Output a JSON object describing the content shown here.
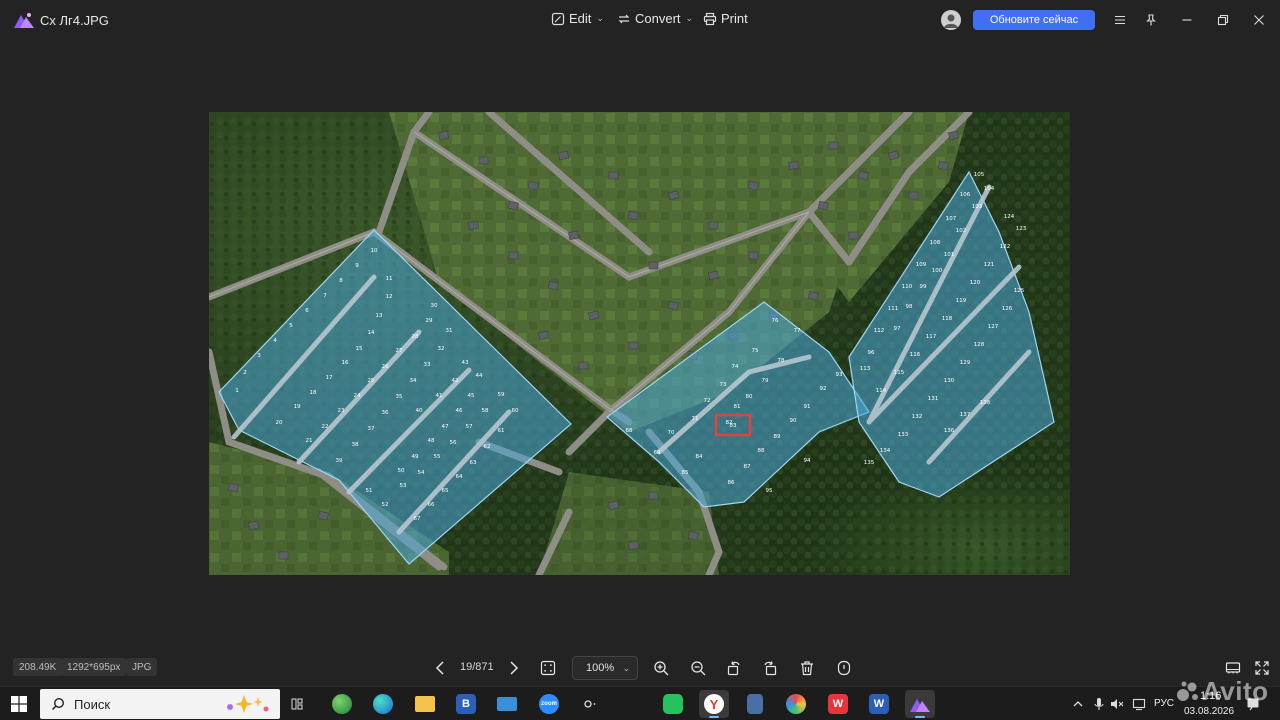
{
  "titlebar": {
    "file_name": "Сх Лг4.JPG",
    "edit_label": "Edit",
    "convert_label": "Convert",
    "print_label": "Print",
    "update_label": "Обновите сейчас"
  },
  "image": {
    "plot_labels": [
      "1",
      "2",
      "3",
      "4",
      "5",
      "6",
      "7",
      "8",
      "9",
      "10",
      "11",
      "12",
      "13",
      "14",
      "15",
      "16",
      "17",
      "18",
      "19",
      "20",
      "21",
      "22",
      "23",
      "24",
      "25",
      "26",
      "27",
      "28",
      "29",
      "30",
      "31",
      "32",
      "33",
      "34",
      "35",
      "36",
      "37",
      "38",
      "39",
      "40",
      "41",
      "42",
      "43",
      "44",
      "45",
      "46",
      "47",
      "48",
      "49",
      "50",
      "51",
      "52",
      "53",
      "54",
      "55",
      "56",
      "57",
      "58",
      "59",
      "60",
      "61",
      "62",
      "63",
      "64",
      "65",
      "66",
      "67",
      "68",
      "69",
      "70",
      "71",
      "72",
      "73",
      "74",
      "75",
      "76",
      "77",
      "78",
      "79",
      "80",
      "81",
      "82",
      "83",
      "84",
      "85",
      "86",
      "87",
      "88",
      "89",
      "90",
      "91",
      "92",
      "93",
      "94",
      "95",
      "96",
      "97",
      "98",
      "99",
      "100",
      "101",
      "102",
      "103",
      "104",
      "105",
      "106",
      "107",
      "108",
      "109",
      "110",
      "111",
      "112",
      "113",
      "114",
      "115",
      "116",
      "117",
      "118",
      "119",
      "120",
      "121",
      "122",
      "123",
      "124",
      "125",
      "126",
      "127",
      "128",
      "129",
      "130",
      "131",
      "132",
      "133",
      "134",
      "135",
      "136",
      "137",
      "138"
    ],
    "highlighted_plot": "83"
  },
  "statusbar": {
    "file_size": "208.49K",
    "dimensions": "1292*695px",
    "format": "JPG",
    "page_counter": "19/871",
    "zoom": "100%"
  },
  "taskbar": {
    "search_placeholder": "Поиск",
    "language": "РУС",
    "time": "1:16",
    "date": "03.08.2026",
    "apps": [
      "task-view",
      "edge-beta",
      "edge",
      "file-explorer",
      "b-app",
      "remote-desktop",
      "zoom",
      "copilot",
      "whatsapp",
      "yandex",
      "calculator",
      "paint",
      "wps",
      "word",
      "photo-viewer"
    ]
  },
  "watermark": {
    "text": "Avito"
  },
  "colors": {
    "accent": "#3f6ff2",
    "plot_fill": "#4aa7d8",
    "highlight": "#e0433a"
  }
}
